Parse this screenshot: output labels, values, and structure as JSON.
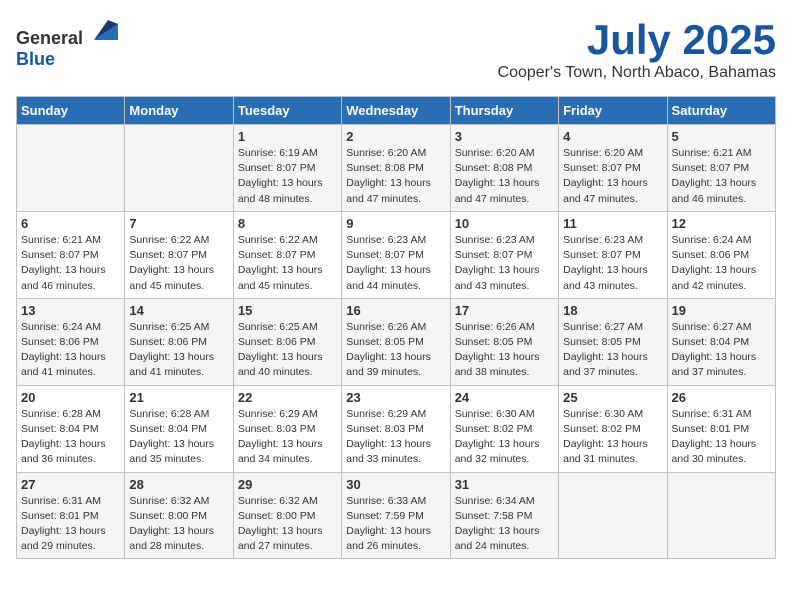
{
  "header": {
    "logo_general": "General",
    "logo_blue": "Blue",
    "month": "July 2025",
    "location": "Cooper's Town, North Abaco, Bahamas"
  },
  "weekdays": [
    "Sunday",
    "Monday",
    "Tuesday",
    "Wednesday",
    "Thursday",
    "Friday",
    "Saturday"
  ],
  "weeks": [
    [
      {
        "day": "",
        "info": ""
      },
      {
        "day": "",
        "info": ""
      },
      {
        "day": "1",
        "info": "Sunrise: 6:19 AM\nSunset: 8:07 PM\nDaylight: 13 hours and 48 minutes."
      },
      {
        "day": "2",
        "info": "Sunrise: 6:20 AM\nSunset: 8:08 PM\nDaylight: 13 hours and 47 minutes."
      },
      {
        "day": "3",
        "info": "Sunrise: 6:20 AM\nSunset: 8:08 PM\nDaylight: 13 hours and 47 minutes."
      },
      {
        "day": "4",
        "info": "Sunrise: 6:20 AM\nSunset: 8:07 PM\nDaylight: 13 hours and 47 minutes."
      },
      {
        "day": "5",
        "info": "Sunrise: 6:21 AM\nSunset: 8:07 PM\nDaylight: 13 hours and 46 minutes."
      }
    ],
    [
      {
        "day": "6",
        "info": "Sunrise: 6:21 AM\nSunset: 8:07 PM\nDaylight: 13 hours and 46 minutes."
      },
      {
        "day": "7",
        "info": "Sunrise: 6:22 AM\nSunset: 8:07 PM\nDaylight: 13 hours and 45 minutes."
      },
      {
        "day": "8",
        "info": "Sunrise: 6:22 AM\nSunset: 8:07 PM\nDaylight: 13 hours and 45 minutes."
      },
      {
        "day": "9",
        "info": "Sunrise: 6:23 AM\nSunset: 8:07 PM\nDaylight: 13 hours and 44 minutes."
      },
      {
        "day": "10",
        "info": "Sunrise: 6:23 AM\nSunset: 8:07 PM\nDaylight: 13 hours and 43 minutes."
      },
      {
        "day": "11",
        "info": "Sunrise: 6:23 AM\nSunset: 8:07 PM\nDaylight: 13 hours and 43 minutes."
      },
      {
        "day": "12",
        "info": "Sunrise: 6:24 AM\nSunset: 8:06 PM\nDaylight: 13 hours and 42 minutes."
      }
    ],
    [
      {
        "day": "13",
        "info": "Sunrise: 6:24 AM\nSunset: 8:06 PM\nDaylight: 13 hours and 41 minutes."
      },
      {
        "day": "14",
        "info": "Sunrise: 6:25 AM\nSunset: 8:06 PM\nDaylight: 13 hours and 41 minutes."
      },
      {
        "day": "15",
        "info": "Sunrise: 6:25 AM\nSunset: 8:06 PM\nDaylight: 13 hours and 40 minutes."
      },
      {
        "day": "16",
        "info": "Sunrise: 6:26 AM\nSunset: 8:05 PM\nDaylight: 13 hours and 39 minutes."
      },
      {
        "day": "17",
        "info": "Sunrise: 6:26 AM\nSunset: 8:05 PM\nDaylight: 13 hours and 38 minutes."
      },
      {
        "day": "18",
        "info": "Sunrise: 6:27 AM\nSunset: 8:05 PM\nDaylight: 13 hours and 37 minutes."
      },
      {
        "day": "19",
        "info": "Sunrise: 6:27 AM\nSunset: 8:04 PM\nDaylight: 13 hours and 37 minutes."
      }
    ],
    [
      {
        "day": "20",
        "info": "Sunrise: 6:28 AM\nSunset: 8:04 PM\nDaylight: 13 hours and 36 minutes."
      },
      {
        "day": "21",
        "info": "Sunrise: 6:28 AM\nSunset: 8:04 PM\nDaylight: 13 hours and 35 minutes."
      },
      {
        "day": "22",
        "info": "Sunrise: 6:29 AM\nSunset: 8:03 PM\nDaylight: 13 hours and 34 minutes."
      },
      {
        "day": "23",
        "info": "Sunrise: 6:29 AM\nSunset: 8:03 PM\nDaylight: 13 hours and 33 minutes."
      },
      {
        "day": "24",
        "info": "Sunrise: 6:30 AM\nSunset: 8:02 PM\nDaylight: 13 hours and 32 minutes."
      },
      {
        "day": "25",
        "info": "Sunrise: 6:30 AM\nSunset: 8:02 PM\nDaylight: 13 hours and 31 minutes."
      },
      {
        "day": "26",
        "info": "Sunrise: 6:31 AM\nSunset: 8:01 PM\nDaylight: 13 hours and 30 minutes."
      }
    ],
    [
      {
        "day": "27",
        "info": "Sunrise: 6:31 AM\nSunset: 8:01 PM\nDaylight: 13 hours and 29 minutes."
      },
      {
        "day": "28",
        "info": "Sunrise: 6:32 AM\nSunset: 8:00 PM\nDaylight: 13 hours and 28 minutes."
      },
      {
        "day": "29",
        "info": "Sunrise: 6:32 AM\nSunset: 8:00 PM\nDaylight: 13 hours and 27 minutes."
      },
      {
        "day": "30",
        "info": "Sunrise: 6:33 AM\nSunset: 7:59 PM\nDaylight: 13 hours and 26 minutes."
      },
      {
        "day": "31",
        "info": "Sunrise: 6:34 AM\nSunset: 7:58 PM\nDaylight: 13 hours and 24 minutes."
      },
      {
        "day": "",
        "info": ""
      },
      {
        "day": "",
        "info": ""
      }
    ]
  ]
}
